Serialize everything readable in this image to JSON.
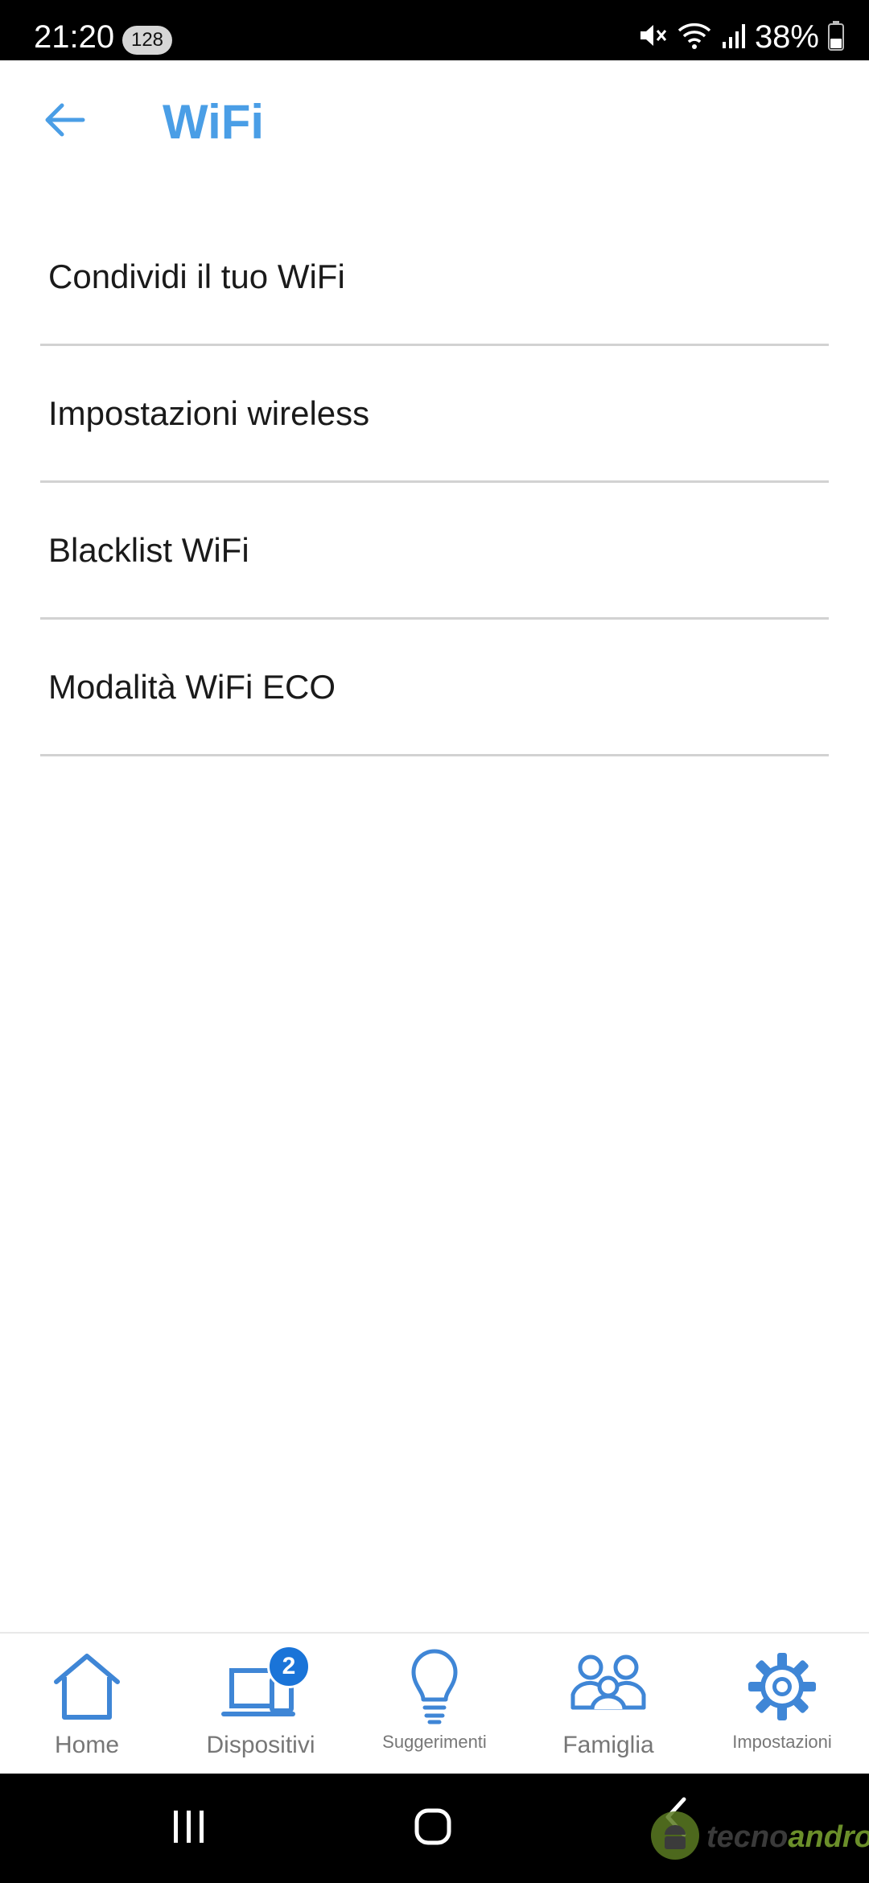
{
  "status_bar": {
    "time": "21:20",
    "notification_count": "128",
    "battery": "38%",
    "icons": [
      "mute-icon",
      "wifi-icon",
      "signal-icon",
      "battery-icon"
    ]
  },
  "header": {
    "title": "WiFi",
    "back_icon": "arrow-left-icon",
    "accent_color": "#4a9ee6"
  },
  "menu": {
    "items": [
      {
        "label": "Condividi il tuo WiFi"
      },
      {
        "label": "Impostazioni wireless"
      },
      {
        "label": "Blacklist WiFi"
      },
      {
        "label": "Modalità WiFi ECO"
      }
    ]
  },
  "bottom_nav": {
    "items": [
      {
        "label": "Home",
        "icon": "home-icon"
      },
      {
        "label": "Dispositivi",
        "icon": "devices-icon",
        "badge": "2"
      },
      {
        "label": "Suggerimenti",
        "icon": "lightbulb-icon"
      },
      {
        "label": "Famiglia",
        "icon": "family-icon"
      },
      {
        "label": "Impostazioni",
        "icon": "gear-icon"
      }
    ],
    "icon_color": "#3f86d6",
    "badge_color": "#1a74d8"
  },
  "system_nav": {
    "buttons": [
      "recents-icon",
      "home-circle-icon",
      "back-chevron-icon"
    ]
  },
  "watermark": {
    "text_a": "tecno",
    "text_b": "android"
  }
}
